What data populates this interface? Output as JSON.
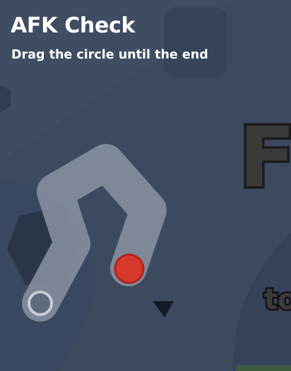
{
  "modal": {
    "title": "AFK Check",
    "instruction": "Drag the circle until the end"
  },
  "background": {
    "logo_fragment": "Fl",
    "tagline_fragment": "to"
  },
  "colors": {
    "background": "#3c495e",
    "track": "#8a93a3",
    "handle": "#d7392c",
    "handle_border": "#b3241b",
    "end_marker_border": "#c7ccd4"
  },
  "icons": {
    "drag_handle": "red-circle",
    "end_marker": "hollow-circle",
    "cursor": "triangle-pointer"
  }
}
